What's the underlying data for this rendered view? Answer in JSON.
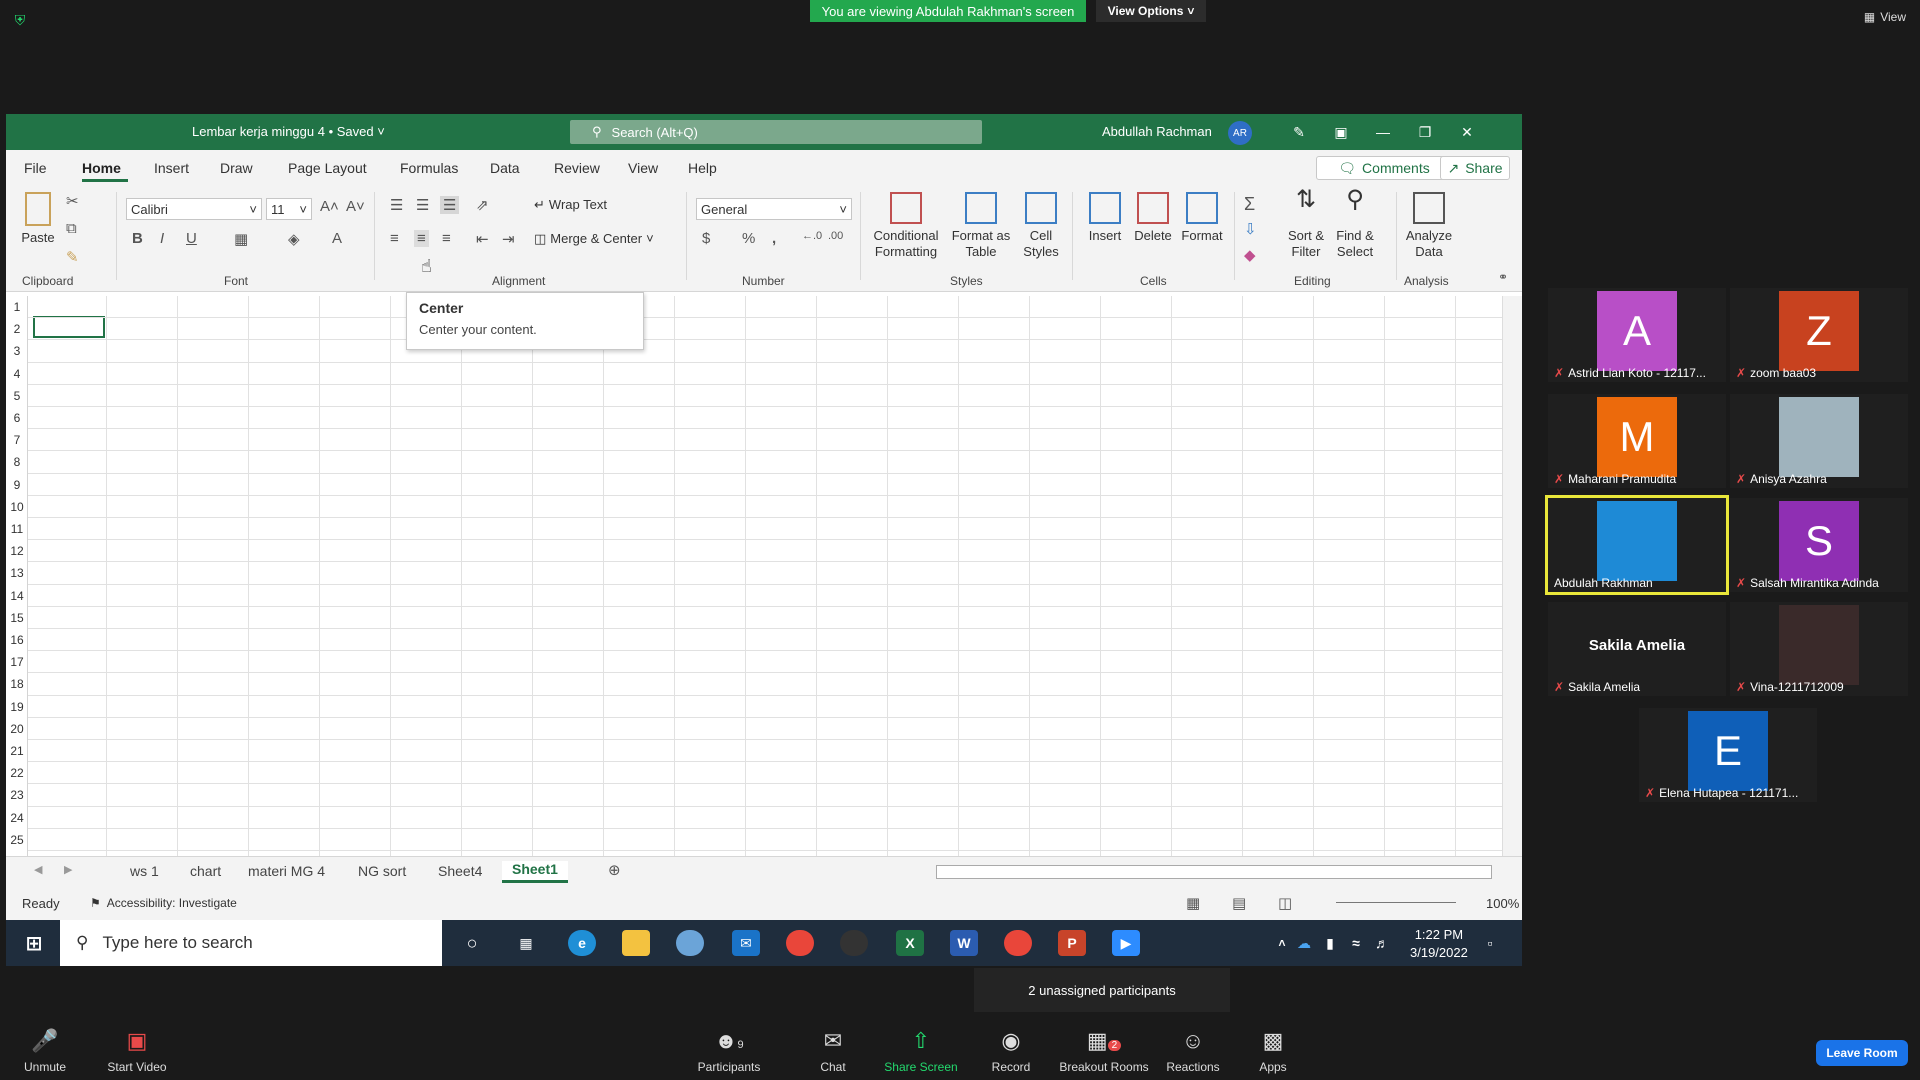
{
  "zoom": {
    "viewing_banner": "You are viewing Abdulah Rakhman's screen",
    "view_options": "View Options",
    "view": "View",
    "unassigned": "2 unassigned participants",
    "toolbar": {
      "unmute": "Unmute",
      "start_video": "Start Video",
      "participants": "Participants",
      "participants_count": "9",
      "chat": "Chat",
      "share_screen": "Share Screen",
      "record": "Record",
      "breakout_rooms": "Breakout Rooms",
      "breakout_badge": "2",
      "reactions": "Reactions",
      "apps": "Apps",
      "leave_room": "Leave Room"
    },
    "participants": [
      {
        "name": "Astrid Lian Koto - 12117...",
        "initial": "A",
        "color": "#b84fc7"
      },
      {
        "name": "zoom baa03",
        "initial": "Z",
        "color": "#c8421f"
      },
      {
        "name": "Maharani Pramudita",
        "initial": "M",
        "color": "#ec6a0c"
      },
      {
        "name": "Anisya Azahra",
        "initial": "",
        "color": "#9fb3bd"
      },
      {
        "name": "Abdulah Rakhman",
        "initial": "",
        "color": "#1e8ad6"
      },
      {
        "name": "Salsah Mirantika Adinda",
        "initial": "S",
        "color": "#8f2fb3"
      },
      {
        "name": "Sakila Amelia",
        "initial": "Sakila Amelia",
        "color": "#1f1f1f"
      },
      {
        "name": "Vina-1211712009",
        "initial": "",
        "color": "#3a2a2a"
      },
      {
        "name": "Elena Hutapea - 121171...",
        "initial": "E",
        "color": "#0f5fb8"
      }
    ]
  },
  "excel": {
    "doc_title": "Lembar kerja minggu 4 • Saved",
    "search_placeholder": "Search (Alt+Q)",
    "user_name": "Abdullah Rachman",
    "user_initials": "AR",
    "menu": [
      "File",
      "Home",
      "Insert",
      "Draw",
      "Page Layout",
      "Formulas",
      "Data",
      "Review",
      "View",
      "Help"
    ],
    "comments": "Comments",
    "share": "Share",
    "ribbon": {
      "paste": "Paste",
      "clipboard": "Clipboard",
      "font_name": "Calibri",
      "font_size": "11",
      "font": "Font",
      "wrap_text": "Wrap Text",
      "merge_center": "Merge & Center",
      "alignment": "Alignment",
      "number_format": "General",
      "number": "Number",
      "conditional_formatting": "Conditional Formatting",
      "format_as_table": "Format as Table",
      "cell_styles": "Cell Styles",
      "styles": "Styles",
      "insert": "Insert",
      "delete": "Delete",
      "format": "Format",
      "cells": "Cells",
      "sort_filter": "Sort & Filter",
      "find_select": "Find & Select",
      "editing": "Editing",
      "analyze_data": "Analyze Data",
      "analysis": "Analysis"
    },
    "tooltip": {
      "title": "Center",
      "desc": "Center your content."
    },
    "rows": [
      "1",
      "2",
      "3",
      "4",
      "5",
      "6",
      "7",
      "8",
      "9",
      "10",
      "11",
      "12",
      "13",
      "14",
      "15",
      "16",
      "17",
      "18",
      "19",
      "20",
      "21",
      "22",
      "23",
      "24",
      "25"
    ],
    "sheets": [
      "ws 1",
      "chart",
      "materi MG 4",
      "NG sort",
      "Sheet4",
      "Sheet1"
    ],
    "status_ready": "Ready",
    "accessibility": "Accessibility: Investigate",
    "zoom_level": "100%"
  },
  "windows": {
    "search": "Type here to search",
    "time": "1:22 PM",
    "date": "3/19/2022"
  }
}
